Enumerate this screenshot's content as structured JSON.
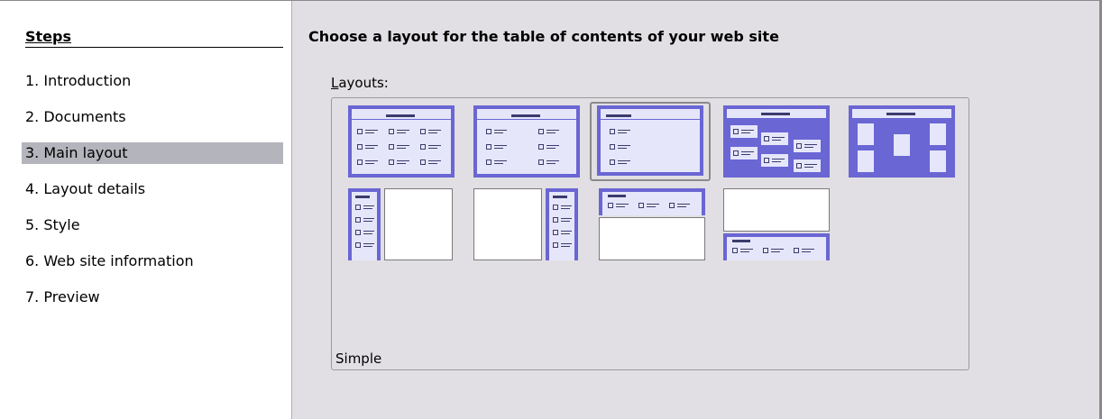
{
  "steps": {
    "title": "Steps",
    "items": [
      {
        "label": "1.  Introduction"
      },
      {
        "label": "2.  Documents"
      },
      {
        "label": "3.  Main layout"
      },
      {
        "label": "4.  Layout details"
      },
      {
        "label": "5.  Style"
      },
      {
        "label": "6.  Web site information"
      },
      {
        "label": "7.  Preview"
      }
    ],
    "active_index": 2
  },
  "main": {
    "title": "Choose a layout for the table of contents of your web site",
    "layouts_label_accel": "L",
    "layouts_label_rest": "ayouts:",
    "selected_caption": "Simple"
  },
  "colors": {
    "panel_bg": "#e1dfe3",
    "tile_accent": "#6a66d4",
    "tile_light": "#e6e6fb",
    "active_step": "#b4b4bc"
  }
}
